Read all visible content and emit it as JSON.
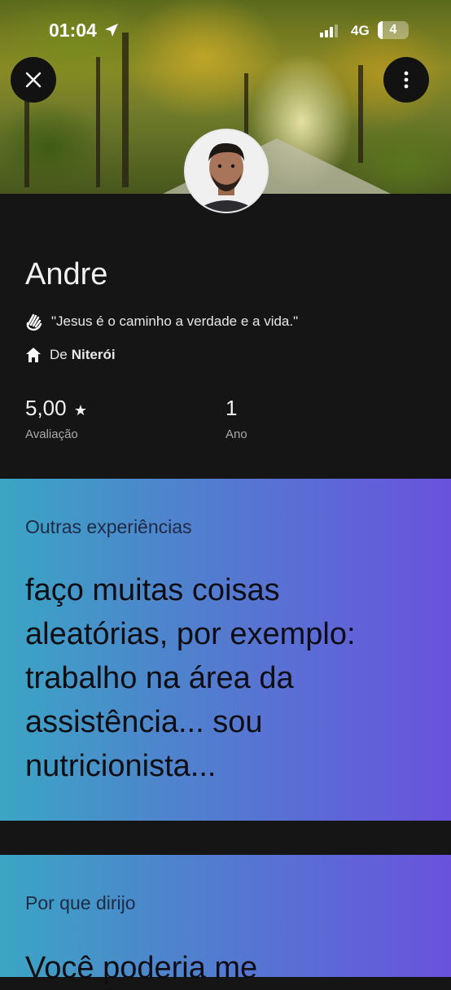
{
  "status_bar": {
    "time": "01:04",
    "network": "4G",
    "battery": "4"
  },
  "profile": {
    "name": "Andre",
    "quote": "\"Jesus é o caminho a verdade e a vida.\"",
    "from_prefix": "De",
    "from_city": "Niterói",
    "rating_value": "5,00",
    "rating_star": "★",
    "rating_label": "Avaliação",
    "years_value": "1",
    "years_label": "Ano"
  },
  "cards": [
    {
      "label": "Outras experiências",
      "lines": [
        "faço muitas coisas",
        "aleatórias, por exemplo:",
        "trabalho na área da",
        "assistência... sou",
        "nutricionista..."
      ]
    },
    {
      "label": "Por que dirijo",
      "lines": [
        "Você poderia me"
      ]
    }
  ],
  "icons": {
    "close": "close-icon",
    "more": "more-vertical-icon",
    "wave": "waving-hand-icon",
    "home": "home-icon",
    "location": "location-arrow-icon",
    "signal": "cell-signal-icon"
  }
}
